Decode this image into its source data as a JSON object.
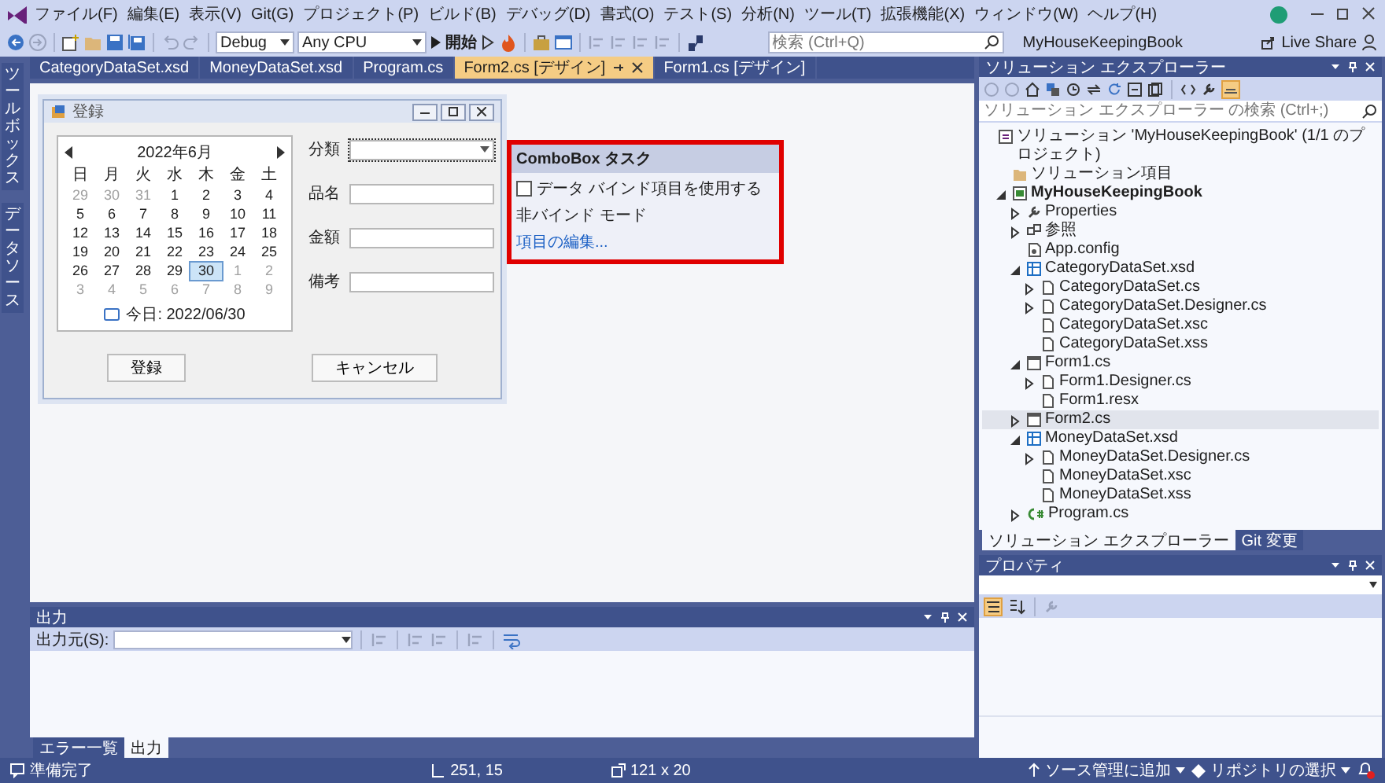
{
  "menu": {
    "items": [
      "ファイル(F)",
      "編集(E)",
      "表示(V)",
      "Git(G)",
      "プロジェクト(P)",
      "ビルド(B)",
      "デバッグ(D)",
      "書式(O)",
      "テスト(S)",
      "分析(N)",
      "ツール(T)",
      "拡張機能(X)",
      "ウィンドウ(W)",
      "ヘルプ(H)"
    ]
  },
  "toolbar": {
    "configuration": "Debug",
    "platform": "Any CPU",
    "start": "開始",
    "search": {
      "placeholder": "検索 (Ctrl+Q)"
    },
    "solution_title": "MyHouseKeepingBook",
    "live_share": "Live Share"
  },
  "side_tabs": [
    "ツールボックス",
    "データソース"
  ],
  "document_tabs": [
    {
      "label": "CategoryDataSet.xsd",
      "selected": false
    },
    {
      "label": "MoneyDataSet.xsd",
      "selected": false
    },
    {
      "label": "Program.cs",
      "selected": false
    },
    {
      "label": "Form2.cs [デザイン]",
      "selected": true
    },
    {
      "label": "Form1.cs [デザイン]",
      "selected": false
    }
  ],
  "designer": {
    "form": {
      "title": "登録",
      "calendar": {
        "month": "2022年6月",
        "weekdays": [
          "日",
          "月",
          "火",
          "水",
          "木",
          "金",
          "土"
        ],
        "weeks": [
          [
            {
              "day": "29",
              "outside": true,
              "selected": false
            },
            {
              "day": "30",
              "outside": true,
              "selected": false
            },
            {
              "day": "31",
              "outside": true,
              "selected": false
            },
            {
              "day": "1",
              "outside": false,
              "selected": false
            },
            {
              "day": "2",
              "outside": false,
              "selected": false
            },
            {
              "day": "3",
              "outside": false,
              "selected": false
            },
            {
              "day": "4",
              "outside": false,
              "selected": false
            }
          ],
          [
            {
              "day": "5",
              "outside": false,
              "selected": false
            },
            {
              "day": "6",
              "outside": false,
              "selected": false
            },
            {
              "day": "7",
              "outside": false,
              "selected": false
            },
            {
              "day": "8",
              "outside": false,
              "selected": false
            },
            {
              "day": "9",
              "outside": false,
              "selected": false
            },
            {
              "day": "10",
              "outside": false,
              "selected": false
            },
            {
              "day": "11",
              "outside": false,
              "selected": false
            }
          ],
          [
            {
              "day": "12",
              "outside": false,
              "selected": false
            },
            {
              "day": "13",
              "outside": false,
              "selected": false
            },
            {
              "day": "14",
              "outside": false,
              "selected": false
            },
            {
              "day": "15",
              "outside": false,
              "selected": false
            },
            {
              "day": "16",
              "outside": false,
              "selected": false
            },
            {
              "day": "17",
              "outside": false,
              "selected": false
            },
            {
              "day": "18",
              "outside": false,
              "selected": false
            }
          ],
          [
            {
              "day": "19",
              "outside": false,
              "selected": false
            },
            {
              "day": "20",
              "outside": false,
              "selected": false
            },
            {
              "day": "21",
              "outside": false,
              "selected": false
            },
            {
              "day": "22",
              "outside": false,
              "selected": false
            },
            {
              "day": "23",
              "outside": false,
              "selected": false
            },
            {
              "day": "24",
              "outside": false,
              "selected": false
            },
            {
              "day": "25",
              "outside": false,
              "selected": false
            }
          ],
          [
            {
              "day": "26",
              "outside": false,
              "selected": false
            },
            {
              "day": "27",
              "outside": false,
              "selected": false
            },
            {
              "day": "28",
              "outside": false,
              "selected": false
            },
            {
              "day": "29",
              "outside": false,
              "selected": false
            },
            {
              "day": "30",
              "outside": false,
              "selected": true
            },
            {
              "day": "1",
              "outside": true,
              "selected": false
            },
            {
              "day": "2",
              "outside": true,
              "selected": false
            }
          ],
          [
            {
              "day": "3",
              "outside": true,
              "selected": false
            },
            {
              "day": "4",
              "outside": true,
              "selected": false
            },
            {
              "day": "5",
              "outside": true,
              "selected": false
            },
            {
              "day": "6",
              "outside": true,
              "selected": false
            },
            {
              "day": "7",
              "outside": true,
              "selected": false
            },
            {
              "day": "8",
              "outside": true,
              "selected": false
            },
            {
              "day": "9",
              "outside": true,
              "selected": false
            }
          ]
        ],
        "today": "今日: 2022/06/30"
      },
      "fields": [
        {
          "label": "分類",
          "kind": "combo"
        },
        {
          "label": "品名",
          "kind": "text"
        },
        {
          "label": "金額",
          "kind": "text"
        },
        {
          "label": "備考",
          "kind": "text"
        }
      ],
      "buttons": [
        "登録",
        "キャンセル"
      ]
    },
    "smart_tag": {
      "title": "ComboBox タスク",
      "option": {
        "label": "データ バインド項目を使用する",
        "checked": false
      },
      "mode": "非バインド モード",
      "link": "項目の編集..."
    }
  },
  "output": {
    "title": "出力",
    "source_label": "出力元(S):",
    "tabs": [
      {
        "label": "エラー一覧",
        "selected": false
      },
      {
        "label": "出力",
        "selected": true
      }
    ]
  },
  "solution_explorer": {
    "title": "ソリューション エクスプローラー",
    "search": {
      "placeholder": "ソリューション エクスプローラー の検索 (Ctrl+;)"
    },
    "tree": [
      {
        "label": "ソリューション 'MyHouseKeepingBook' (1/1 のプロジェクト)",
        "kind": "solution",
        "selected": false,
        "children": [
          {
            "label": "ソリューション項目",
            "kind": "folder",
            "selected": false
          },
          {
            "label": "MyHouseKeepingBook",
            "kind": "project",
            "selected": false,
            "expanded": true,
            "children": [
              {
                "label": "Properties",
                "kind": "properties",
                "selected": false,
                "expanded": false
              },
              {
                "label": "参照",
                "kind": "references",
                "selected": false,
                "expanded": false
              },
              {
                "label": "App.config",
                "kind": "config",
                "selected": false
              },
              {
                "label": "CategoryDataSet.xsd",
                "kind": "dataset",
                "selected": false,
                "expanded": true,
                "children": [
                  {
                    "label": "CategoryDataSet.cs",
                    "kind": "file",
                    "selected": false,
                    "expanded": false
                  },
                  {
                    "label": "CategoryDataSet.Designer.cs",
                    "kind": "file",
                    "selected": false,
                    "expanded": false
                  },
                  {
                    "label": "CategoryDataSet.xsc",
                    "kind": "file",
                    "selected": false
                  },
                  {
                    "label": "CategoryDataSet.xss",
                    "kind": "file",
                    "selected": false
                  }
                ]
              },
              {
                "label": "Form1.cs",
                "kind": "form",
                "selected": false,
                "expanded": true,
                "children": [
                  {
                    "label": "Form1.Designer.cs",
                    "kind": "file",
                    "selected": false,
                    "expanded": false
                  },
                  {
                    "label": "Form1.resx",
                    "kind": "file",
                    "selected": false
                  }
                ]
              },
              {
                "label": "Form2.cs",
                "kind": "form",
                "selected": true,
                "expanded": false
              },
              {
                "label": "MoneyDataSet.xsd",
                "kind": "dataset",
                "selected": false,
                "expanded": true,
                "children": [
                  {
                    "label": "MoneyDataSet.Designer.cs",
                    "kind": "file",
                    "selected": false,
                    "expanded": false
                  },
                  {
                    "label": "MoneyDataSet.xsc",
                    "kind": "file",
                    "selected": false
                  },
                  {
                    "label": "MoneyDataSet.xss",
                    "kind": "file",
                    "selected": false
                  }
                ]
              },
              {
                "label": "Program.cs",
                "kind": "code",
                "selected": false,
                "expanded": false
              }
            ]
          }
        ]
      }
    ],
    "tabs": [
      {
        "label": "ソリューション エクスプローラー",
        "selected": true
      },
      {
        "label": "Git 変更",
        "selected": false
      }
    ]
  },
  "properties": {
    "title": "プロパティ"
  },
  "status_bar": {
    "message": "準備完了",
    "position": "251, 15",
    "size": "121 x 20",
    "source_control": "ソース管理に追加",
    "repository": "リポジトリの選択"
  }
}
